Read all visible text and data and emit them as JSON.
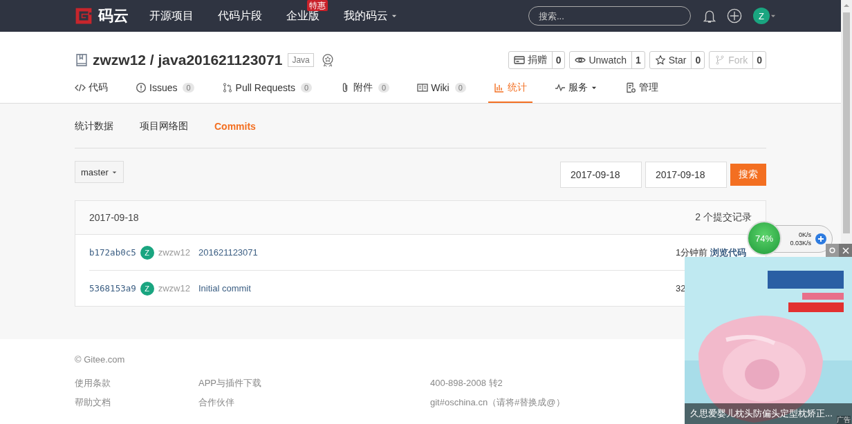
{
  "nav": {
    "logo": "码云",
    "menu": [
      {
        "label": "开源项目"
      },
      {
        "label": "代码片段"
      },
      {
        "label": "企业版",
        "badge": "特惠"
      },
      {
        "label": "我的码云",
        "dropdown": true
      }
    ],
    "search": {
      "placeholder": "搜索..."
    },
    "avatar": "Z"
  },
  "repo": {
    "title": "zwzw12 / java201621123071",
    "language": "Java",
    "actions": [
      {
        "kind": "donate",
        "label": "捐赠",
        "count": "0",
        "disabled": false
      },
      {
        "kind": "watch",
        "label": "Unwatch",
        "count": "1",
        "disabled": false
      },
      {
        "kind": "star",
        "label": "Star",
        "count": "0",
        "disabled": false
      },
      {
        "kind": "fork",
        "label": "Fork",
        "count": "0",
        "disabled": true
      }
    ],
    "tabs": [
      {
        "kind": "code",
        "label": "代码",
        "selected": false
      },
      {
        "kind": "issue",
        "label": "Issues",
        "count": "0",
        "selected": false
      },
      {
        "kind": "pull",
        "label": "Pull Requests",
        "count": "0",
        "selected": false
      },
      {
        "kind": "attach",
        "label": "附件",
        "count": "0",
        "selected": false
      },
      {
        "kind": "wiki",
        "label": "Wiki",
        "count": "0",
        "selected": false
      },
      {
        "kind": "stats",
        "label": "统计",
        "selected": true
      },
      {
        "kind": "service",
        "label": "服务",
        "dropdown": true,
        "selected": false
      },
      {
        "kind": "manage",
        "label": "管理",
        "selected": false
      }
    ]
  },
  "subtabs": [
    {
      "label": "统计数据",
      "selected": false
    },
    {
      "label": "项目网络图",
      "selected": false
    },
    {
      "label": "Commits",
      "selected": true
    }
  ],
  "branch": "master",
  "date_from": "2017-09-18",
  "date_to": "2017-09-18",
  "search_button": "搜索",
  "commits": {
    "date": "2017-09-18",
    "summary": "2 个提交记录",
    "rows": [
      {
        "sha": "b172ab0c5",
        "avatar": "Z",
        "author": "zwzw12",
        "message": "201621123071",
        "time": "1分钟前",
        "link": "浏览代码"
      },
      {
        "sha": "5368153a9",
        "avatar": "Z",
        "author": "zwzw12",
        "message": "Initial commit",
        "time": "32"
      }
    ]
  },
  "footer": {
    "copyright": "© Gitee.com",
    "columns": [
      [
        "使用条款",
        "帮助文档"
      ],
      [
        "APP与插件下载",
        "合作伙伴"
      ],
      [
        "400-898-2008 转2",
        "git#oschina.cn（请将#替换成@）"
      ]
    ]
  },
  "monitor": {
    "percent": "74%",
    "up": "0K/s",
    "down": "0.03K/s"
  },
  "ad": {
    "caption": "久思爱婴儿枕头防偏头定型枕矫正...",
    "tag": "广告"
  }
}
